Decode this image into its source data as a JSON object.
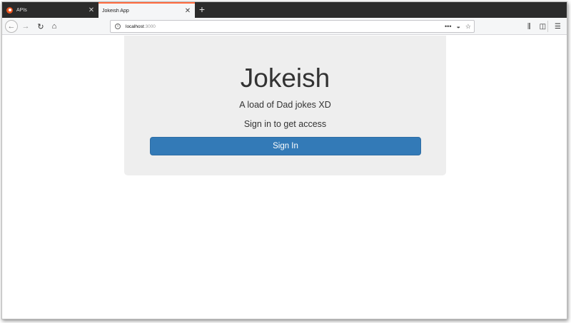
{
  "browser": {
    "tabs": [
      {
        "title": "APIs",
        "active": false
      },
      {
        "title": "Jokeish App",
        "active": true
      }
    ],
    "new_tab_label": "+",
    "url": {
      "host": "localhost",
      "port": ":3000"
    },
    "icons": {
      "back": "arrow-left-icon",
      "forward": "arrow-right-icon",
      "reload": "reload-icon",
      "home": "home-icon",
      "site_info": "info-icon",
      "page_actions": "more-dots-icon",
      "pocket": "pocket-icon",
      "bookmark": "star-icon",
      "library": "library-icon",
      "sidebar": "sidebar-icon",
      "menu": "hamburger-menu-icon"
    },
    "accent_color": "#ff6a3d"
  },
  "page": {
    "title": "Jokeish",
    "tagline": "A load of Dad jokes XD",
    "access_text": "Sign in to get access",
    "signin_label": "Sign In",
    "button_color": "#337ab7"
  }
}
